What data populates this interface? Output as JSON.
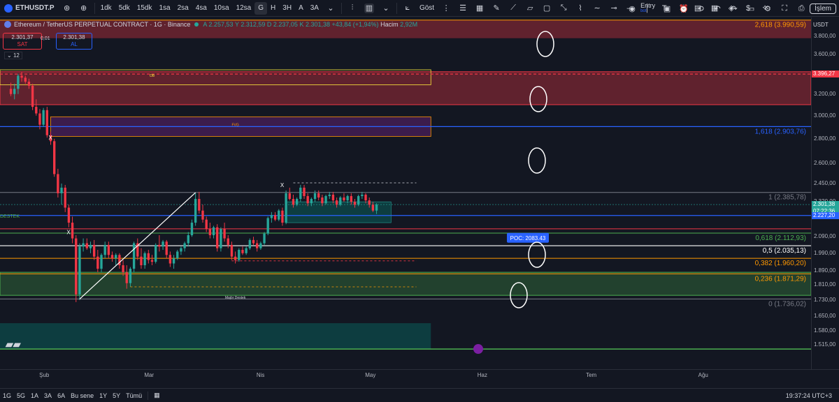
{
  "topbar": {
    "symbol": "ETHUSDT.P",
    "intervals": [
      "1dk",
      "5dk",
      "15dk",
      "1sa",
      "2sa",
      "4sa",
      "10sa",
      "12sa",
      "G",
      "H",
      "3H",
      "A",
      "3A"
    ],
    "active_interval": "G",
    "indicators_label": "Göst",
    "entry_label": "Entry",
    "entry_sub": "bot",
    "trade_label": "İşlem"
  },
  "legend": {
    "title": "Ethereum / TetherUS PERPETUAL CONTRACT · 1G · Binance",
    "open": "A 2.257,53",
    "high": "Y 2.312,59",
    "low": "D 2.237,05",
    "close": "K 2.301,38",
    "change": "+43,84 (+1,94%)",
    "volume_label": "Hacim",
    "volume": "2,92M"
  },
  "trade": {
    "sell_price": "2.301,37",
    "sell_label": "SAT",
    "spread": "0,01",
    "buy_price": "2.301,38",
    "buy_label": "AL",
    "indicator_count": "12"
  },
  "chart_labels": {
    "ob": "OB",
    "fvg": "FVG",
    "major": "Majör Destek",
    "destek": "DESTEK",
    "x1": "X",
    "x2": "X",
    "x3": "X",
    "poc": "POC: 2083.43"
  },
  "fib_labels": [
    {
      "text": "2,618 (3.990,59)",
      "color": "#ff9800"
    },
    {
      "text": "1,618 (2.903,76)",
      "color": "#2962ff"
    },
    {
      "text": "1 (2.385,78)",
      "color": "#787b86"
    },
    {
      "text": "0,618 (2.112,93)",
      "color": "#4caf50"
    },
    {
      "text": "0,5 (2.035,13)",
      "color": "#ffffff"
    },
    {
      "text": "0,382 (1.960,20)",
      "color": "#ff9800"
    },
    {
      "text": "0,236 (1.871,29)",
      "color": "#ff9800"
    },
    {
      "text": "0 (1.736,02)",
      "color": "#787b86"
    }
  ],
  "price_axis": {
    "currency": "USDT",
    "ticks": [
      "3.800,00",
      "3.600,00",
      "3.400,00",
      "3.200,00",
      "3.000,00",
      "2.800,00",
      "2.600,00",
      "2.450,00",
      "2.320,00",
      "2.090,00",
      "1.990,00",
      "1.890,00",
      "1.810,00",
      "1.730,00",
      "1.650,00",
      "1.580,00",
      "1.515,00"
    ],
    "tag_red": "3.396,27",
    "tag_last": "2.301,38",
    "tag_time": "07:22:36",
    "tag_blue": "2.227,20"
  },
  "time_axis": {
    "labels": [
      "Şub",
      "Mar",
      "Nis",
      "May",
      "Haz",
      "Tem",
      "Ağu"
    ]
  },
  "bottombar": {
    "ranges": [
      "1G",
      "5G",
      "1A",
      "3A",
      "6A",
      "Bu sene",
      "1Y",
      "5Y",
      "Tümü"
    ],
    "clock": "19:37:24 UTC+3"
  },
  "colors": {
    "up": "#26a69a",
    "down": "#f23645",
    "bg": "#131722",
    "accent": "#2962ff"
  },
  "chart_data": {
    "type": "candlestick",
    "candles": [
      {
        "x": "2024-01-23",
        "o": 3250,
        "h": 3310,
        "l": 3180,
        "c": 3200
      },
      {
        "x": "2024-01-24",
        "o": 3200,
        "h": 3300,
        "l": 3150,
        "c": 3250
      },
      {
        "x": "2024-01-25",
        "o": 3250,
        "h": 3400,
        "l": 3200,
        "c": 3380
      },
      {
        "x": "2024-01-26",
        "o": 3380,
        "h": 3420,
        "l": 3320,
        "c": 3360
      },
      {
        "x": "2024-01-27",
        "o": 3360,
        "h": 3380,
        "l": 3300,
        "c": 3320
      },
      {
        "x": "2024-01-28",
        "o": 3320,
        "h": 3350,
        "l": 3250,
        "c": 3280
      },
      {
        "x": "2024-01-29",
        "o": 3280,
        "h": 3300,
        "l": 3050,
        "c": 3080
      },
      {
        "x": "2024-01-30",
        "o": 3080,
        "h": 3150,
        "l": 3000,
        "c": 3020
      },
      {
        "x": "2024-01-31",
        "o": 3020,
        "h": 3060,
        "l": 2880,
        "c": 2920
      },
      {
        "x": "2024-02-01",
        "o": 2920,
        "h": 3070,
        "l": 2900,
        "c": 3050
      },
      {
        "x": "2024-02-02",
        "o": 3050,
        "h": 3080,
        "l": 2810,
        "c": 2830
      },
      {
        "x": "2024-02-03",
        "o": 2830,
        "h": 2860,
        "l": 2750,
        "c": 2780
      },
      {
        "x": "2024-02-04",
        "o": 2780,
        "h": 2800,
        "l": 2500,
        "c": 2520
      },
      {
        "x": "2024-02-05",
        "o": 2520,
        "h": 2560,
        "l": 2350,
        "c": 2380
      },
      {
        "x": "2024-02-06",
        "o": 2380,
        "h": 2450,
        "l": 2300,
        "c": 2420
      },
      {
        "x": "2024-02-07",
        "o": 2420,
        "h": 2440,
        "l": 2250,
        "c": 2280
      },
      {
        "x": "2024-02-08",
        "o": 2280,
        "h": 2300,
        "l": 2150,
        "c": 2180
      },
      {
        "x": "2024-02-09",
        "o": 2180,
        "h": 2220,
        "l": 2050,
        "c": 2080
      },
      {
        "x": "2024-02-10",
        "o": 2080,
        "h": 2100,
        "l": 1720,
        "c": 1760
      },
      {
        "x": "2024-02-11",
        "o": 1760,
        "h": 2050,
        "l": 1730,
        "c": 2030
      },
      {
        "x": "2024-02-12",
        "o": 2030,
        "h": 2080,
        "l": 2000,
        "c": 2050
      },
      {
        "x": "2024-02-13",
        "o": 2050,
        "h": 2080,
        "l": 2010,
        "c": 2020
      },
      {
        "x": "2024-02-14",
        "o": 2020,
        "h": 2060,
        "l": 1990,
        "c": 2040
      },
      {
        "x": "2024-02-15",
        "o": 2040,
        "h": 2070,
        "l": 1950,
        "c": 1970
      },
      {
        "x": "2024-02-16",
        "o": 1970,
        "h": 2010,
        "l": 1880,
        "c": 1900
      },
      {
        "x": "2024-02-17",
        "o": 1900,
        "h": 1990,
        "l": 1880,
        "c": 1980
      },
      {
        "x": "2024-02-18",
        "o": 1980,
        "h": 2060,
        "l": 1960,
        "c": 2040
      },
      {
        "x": "2024-02-19",
        "o": 2040,
        "h": 2060,
        "l": 1960,
        "c": 1980
      },
      {
        "x": "2024-02-20",
        "o": 1980,
        "h": 2000,
        "l": 1940,
        "c": 1960
      },
      {
        "x": "2024-02-21",
        "o": 1960,
        "h": 1990,
        "l": 1920,
        "c": 1980
      },
      {
        "x": "2024-02-22",
        "o": 1980,
        "h": 1990,
        "l": 1900,
        "c": 1920
      },
      {
        "x": "2024-02-23",
        "o": 1920,
        "h": 1950,
        "l": 1860,
        "c": 1880
      },
      {
        "x": "2024-02-24",
        "o": 1880,
        "h": 1920,
        "l": 1790,
        "c": 1820
      },
      {
        "x": "2024-02-25",
        "o": 1820,
        "h": 1910,
        "l": 1800,
        "c": 1900
      },
      {
        "x": "2024-02-26",
        "o": 1900,
        "h": 2060,
        "l": 1880,
        "c": 2050
      },
      {
        "x": "2024-02-27",
        "o": 2050,
        "h": 2080,
        "l": 1950,
        "c": 1970
      },
      {
        "x": "2024-02-28",
        "o": 1970,
        "h": 2020,
        "l": 1900,
        "c": 1920
      },
      {
        "x": "2024-02-29",
        "o": 1920,
        "h": 2000,
        "l": 1900,
        "c": 1990
      },
      {
        "x": "2024-03-01",
        "o": 1990,
        "h": 2010,
        "l": 1930,
        "c": 1950
      },
      {
        "x": "2024-03-02",
        "o": 1950,
        "h": 1980,
        "l": 1920,
        "c": 1940
      },
      {
        "x": "2024-03-03",
        "o": 1940,
        "h": 2050,
        "l": 1930,
        "c": 2040
      },
      {
        "x": "2024-03-04",
        "o": 2040,
        "h": 2100,
        "l": 2000,
        "c": 2030
      },
      {
        "x": "2024-03-05",
        "o": 2030,
        "h": 2070,
        "l": 2010,
        "c": 2060
      },
      {
        "x": "2024-03-06",
        "o": 2060,
        "h": 2070,
        "l": 1960,
        "c": 1980
      },
      {
        "x": "2024-03-07",
        "o": 1980,
        "h": 2000,
        "l": 1910,
        "c": 1930
      },
      {
        "x": "2024-03-08",
        "o": 1930,
        "h": 1980,
        "l": 1900,
        "c": 1960
      },
      {
        "x": "2024-03-09",
        "o": 1960,
        "h": 2010,
        "l": 1950,
        "c": 2000
      },
      {
        "x": "2024-03-10",
        "o": 2000,
        "h": 2030,
        "l": 1980,
        "c": 2020
      },
      {
        "x": "2024-03-11",
        "o": 2020,
        "h": 2060,
        "l": 2000,
        "c": 2050
      },
      {
        "x": "2024-03-12",
        "o": 2050,
        "h": 2120,
        "l": 2030,
        "c": 2100
      },
      {
        "x": "2024-03-13",
        "o": 2100,
        "h": 2200,
        "l": 2090,
        "c": 2180
      },
      {
        "x": "2024-03-14",
        "o": 2180,
        "h": 2380,
        "l": 2160,
        "c": 2340
      },
      {
        "x": "2024-03-15",
        "o": 2340,
        "h": 2390,
        "l": 2240,
        "c": 2260
      },
      {
        "x": "2024-03-16",
        "o": 2260,
        "h": 2300,
        "l": 2180,
        "c": 2200
      },
      {
        "x": "2024-03-17",
        "o": 2200,
        "h": 2220,
        "l": 2120,
        "c": 2140
      },
      {
        "x": "2024-03-18",
        "o": 2140,
        "h": 2180,
        "l": 2080,
        "c": 2100
      },
      {
        "x": "2024-03-19",
        "o": 2100,
        "h": 2160,
        "l": 2080,
        "c": 2150
      },
      {
        "x": "2024-03-20",
        "o": 2150,
        "h": 2170,
        "l": 2000,
        "c": 2020
      },
      {
        "x": "2024-03-21",
        "o": 2020,
        "h": 2150,
        "l": 2000,
        "c": 2140
      },
      {
        "x": "2024-03-22",
        "o": 2140,
        "h": 2180,
        "l": 2060,
        "c": 2080
      },
      {
        "x": "2024-03-23",
        "o": 2080,
        "h": 2100,
        "l": 2020,
        "c": 2040
      },
      {
        "x": "2024-03-24",
        "o": 2040,
        "h": 2060,
        "l": 1950,
        "c": 1970
      },
      {
        "x": "2024-03-25",
        "o": 1970,
        "h": 2000,
        "l": 1930,
        "c": 1950
      },
      {
        "x": "2024-03-26",
        "o": 1950,
        "h": 2020,
        "l": 1940,
        "c": 2010
      },
      {
        "x": "2024-03-27",
        "o": 2010,
        "h": 2030,
        "l": 1980,
        "c": 1990
      },
      {
        "x": "2024-03-28",
        "o": 1990,
        "h": 2030,
        "l": 1980,
        "c": 2020
      },
      {
        "x": "2024-03-29",
        "o": 2020,
        "h": 2080,
        "l": 2010,
        "c": 2070
      },
      {
        "x": "2024-03-30",
        "o": 2070,
        "h": 2090,
        "l": 2040,
        "c": 2050
      },
      {
        "x": "2024-03-31",
        "o": 2050,
        "h": 2070,
        "l": 2000,
        "c": 2020
      },
      {
        "x": "2024-04-01",
        "o": 2020,
        "h": 2060,
        "l": 2010,
        "c": 2050
      },
      {
        "x": "2024-04-02",
        "o": 2050,
        "h": 2120,
        "l": 2040,
        "c": 2110
      },
      {
        "x": "2024-04-03",
        "o": 2110,
        "h": 2220,
        "l": 2100,
        "c": 2210
      },
      {
        "x": "2024-04-04",
        "o": 2210,
        "h": 2250,
        "l": 2180,
        "c": 2230
      },
      {
        "x": "2024-04-05",
        "o": 2230,
        "h": 2250,
        "l": 2190,
        "c": 2200
      },
      {
        "x": "2024-04-06",
        "o": 2200,
        "h": 2270,
        "l": 2190,
        "c": 2260
      },
      {
        "x": "2024-04-07",
        "o": 2260,
        "h": 2280,
        "l": 2160,
        "c": 2180
      },
      {
        "x": "2024-04-08",
        "o": 2180,
        "h": 2400,
        "l": 2170,
        "c": 2380
      },
      {
        "x": "2024-04-09",
        "o": 2380,
        "h": 2420,
        "l": 2330,
        "c": 2340
      },
      {
        "x": "2024-04-10",
        "o": 2340,
        "h": 2370,
        "l": 2280,
        "c": 2300
      },
      {
        "x": "2024-04-11",
        "o": 2300,
        "h": 2350,
        "l": 2290,
        "c": 2340
      },
      {
        "x": "2024-04-12",
        "o": 2340,
        "h": 2440,
        "l": 2320,
        "c": 2420
      },
      {
        "x": "2024-04-13",
        "o": 2420,
        "h": 2440,
        "l": 2340,
        "c": 2360
      },
      {
        "x": "2024-04-14",
        "o": 2360,
        "h": 2380,
        "l": 2290,
        "c": 2310
      },
      {
        "x": "2024-04-15",
        "o": 2310,
        "h": 2350,
        "l": 2290,
        "c": 2340
      },
      {
        "x": "2024-04-16",
        "o": 2340,
        "h": 2400,
        "l": 2320,
        "c": 2380
      },
      {
        "x": "2024-04-17",
        "o": 2380,
        "h": 2400,
        "l": 2330,
        "c": 2350
      },
      {
        "x": "2024-04-18",
        "o": 2350,
        "h": 2370,
        "l": 2290,
        "c": 2310
      },
      {
        "x": "2024-04-19",
        "o": 2310,
        "h": 2370,
        "l": 2300,
        "c": 2360
      },
      {
        "x": "2024-04-20",
        "o": 2360,
        "h": 2390,
        "l": 2340,
        "c": 2370
      },
      {
        "x": "2024-04-21",
        "o": 2370,
        "h": 2390,
        "l": 2310,
        "c": 2330
      },
      {
        "x": "2024-04-22",
        "o": 2330,
        "h": 2350,
        "l": 2280,
        "c": 2300
      },
      {
        "x": "2024-04-23",
        "o": 2300,
        "h": 2360,
        "l": 2290,
        "c": 2350
      },
      {
        "x": "2024-04-24",
        "o": 2350,
        "h": 2380,
        "l": 2320,
        "c": 2330
      },
      {
        "x": "2024-04-25",
        "o": 2330,
        "h": 2370,
        "l": 2310,
        "c": 2360
      },
      {
        "x": "2024-04-26",
        "o": 2360,
        "h": 2380,
        "l": 2300,
        "c": 2320
      },
      {
        "x": "2024-04-27",
        "o": 2320,
        "h": 2340,
        "l": 2280,
        "c": 2300
      },
      {
        "x": "2024-04-28",
        "o": 2300,
        "h": 2370,
        "l": 2290,
        "c": 2360
      },
      {
        "x": "2024-04-29",
        "o": 2360,
        "h": 2390,
        "l": 2340,
        "c": 2370
      },
      {
        "x": "2024-04-30",
        "o": 2370,
        "h": 2380,
        "l": 2310,
        "c": 2330
      },
      {
        "x": "2024-05-01",
        "o": 2330,
        "h": 2350,
        "l": 2280,
        "c": 2300
      },
      {
        "x": "2024-05-02",
        "o": 2300,
        "h": 2320,
        "l": 2250,
        "c": 2260
      },
      {
        "x": "2024-05-03",
        "o": 2260,
        "h": 2310,
        "l": 2237,
        "c": 2301
      }
    ],
    "xlim": [
      "2024-01-20",
      "2024-08-31"
    ],
    "ylim": [
      1480,
      3980
    ],
    "y_scale": "log",
    "last_price": 2301.38,
    "horizontal_levels": [
      3990.59,
      2903.76,
      2385.78,
      2112.93,
      2035.13,
      1960.2,
      1871.29,
      1736.02,
      2227.2,
      3396.27
    ],
    "poc": 2083.43
  }
}
